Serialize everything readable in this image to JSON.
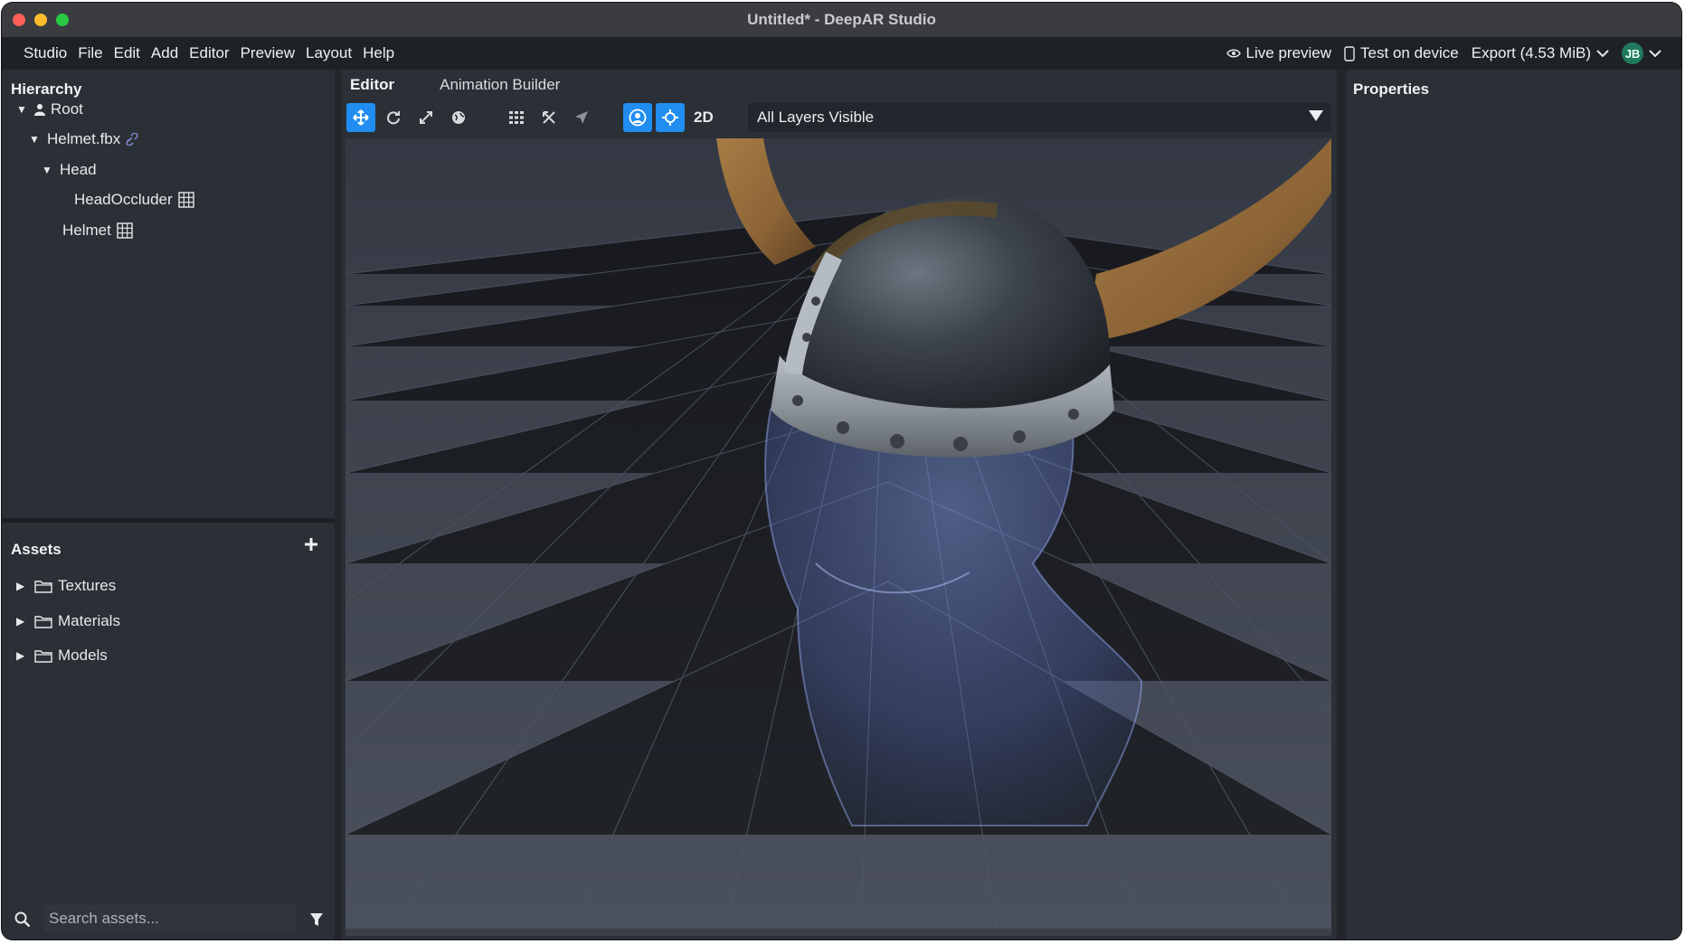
{
  "window": {
    "title": "Untitled* - DeepAR Studio"
  },
  "menu": {
    "items": [
      "Studio",
      "File",
      "Edit",
      "Add",
      "Editor",
      "Preview",
      "Layout",
      "Help"
    ],
    "live_preview": "Live preview",
    "test_on_device": "Test on device",
    "export": "Export (4.53 MiB)",
    "user_initials": "JB"
  },
  "hierarchy": {
    "title": "Hierarchy",
    "root": "Root",
    "helmet_fbx": "Helmet.fbx",
    "head": "Head",
    "head_occluder": "HeadOccluder",
    "helmet": "Helmet"
  },
  "assets": {
    "title": "Assets",
    "folders": [
      "Textures",
      "Materials",
      "Models"
    ],
    "search_placeholder": "Search assets..."
  },
  "editor": {
    "tabs": [
      "Editor",
      "Animation Builder"
    ],
    "mode_2d": "2D",
    "layers": "All Layers Visible"
  },
  "properties": {
    "title": "Properties"
  },
  "colors": {
    "accent": "#1f8ef0",
    "panel": "#2b2f36",
    "menubar": "#1e2126",
    "avatar": "#1f7a5c"
  }
}
